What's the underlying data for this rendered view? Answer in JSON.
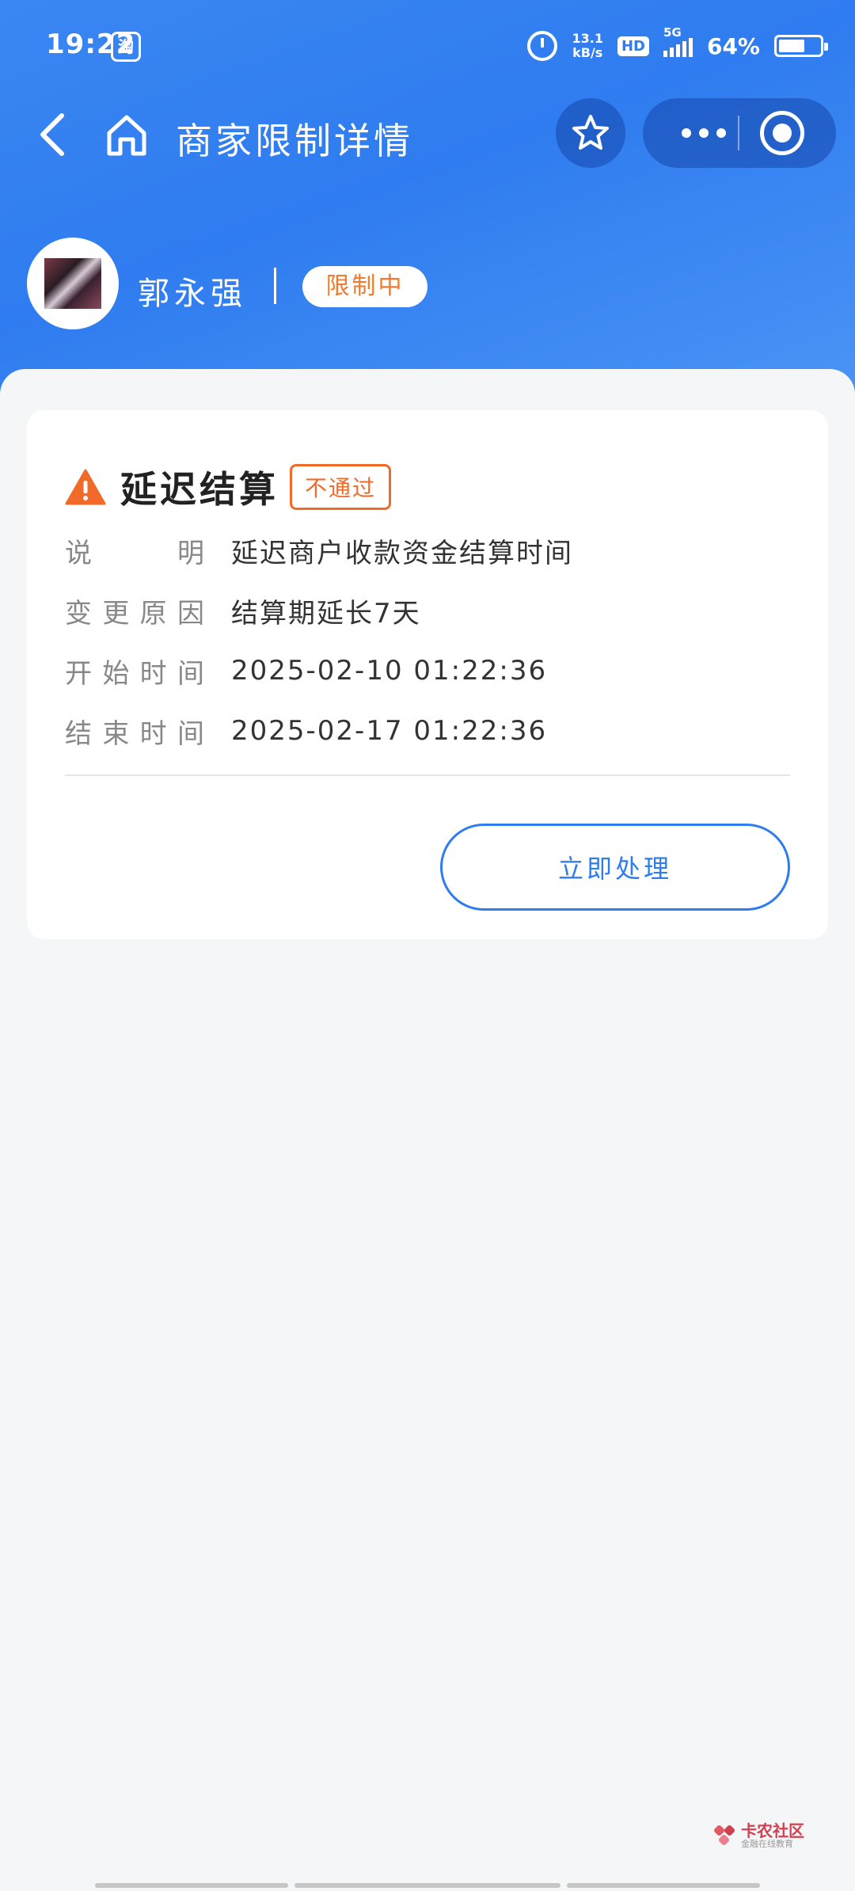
{
  "status_bar": {
    "time": "19:22",
    "app_badge": "淘",
    "net_speed_value": "13.1",
    "net_speed_unit": "kB/s",
    "hd": "HD",
    "network": "5G",
    "battery": "64%",
    "battery_level": 0.64
  },
  "nav": {
    "title": "商家限制详情"
  },
  "merchant": {
    "name": "郭永强",
    "status": "限制中"
  },
  "rule": {
    "title": "延迟结算",
    "result": "不通过",
    "rows": [
      {
        "label_chars": [
          "说",
          "明"
        ],
        "value": "延迟商户收款资金结算时间"
      },
      {
        "label_chars": [
          "变",
          "更",
          "原",
          "因"
        ],
        "value": "结算期延长7天"
      },
      {
        "label_chars": [
          "开",
          "始",
          "时",
          "间"
        ],
        "value": "2025-02-10 01:22:36"
      },
      {
        "label_chars": [
          "结",
          "束",
          "时",
          "间"
        ],
        "value": "2025-02-17 01:22:36"
      }
    ],
    "action_label": "立即处理"
  },
  "watermark": {
    "line1": "卡农社区",
    "line2": "金融在线教育"
  },
  "colors": {
    "brand_blue": "#2f7cf0",
    "warning_orange": "#f26a2a"
  }
}
